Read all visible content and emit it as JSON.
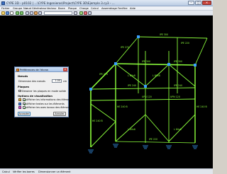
{
  "window": {
    "title": "CYPE 3D - p0102 | ...\\CYPE Ingenieros\\Project\\CYPE 3D\\Ejemplo 3.cy3 - ...",
    "minimize": "–",
    "maximize": "□",
    "close": "✕"
  },
  "menubar": {
    "items": [
      "Fichier",
      "Groupe",
      "Nœud",
      "Générateur",
      "Vecteur",
      "Barre",
      "Plaque",
      "Charge",
      "Calcul",
      "Assemblage",
      "Fenêtre",
      "Aide"
    ]
  },
  "toolbar": {
    "field": ""
  },
  "dialog": {
    "title": "Préférences de l'écran",
    "close": "✕",
    "group_nodes": "Nœuds",
    "node_size_label": "Dimension des nœuds",
    "node_size_value": "1.00",
    "node_size_unit": "cm",
    "group_plaques": "Plaques",
    "chk_plaques_label": "Dessiner les plaques en mode solide",
    "group_visualization": "Options de visualisation",
    "opt1_label": "Afficher les informations des éléments",
    "opt2_label": "Afficher textes sur les éléments",
    "opt3_label": "Afficher les axes locaux des éléments",
    "accept": "Accepter",
    "cancel": "Annuler"
  },
  "viewport": {
    "line_color": "#8cff3c",
    "node_color": "#3aa0ff",
    "labels": [
      "IPE 300",
      "IPE 300",
      "IPE 300",
      "HE 240 B",
      "HE 240 B",
      "HE 240 B",
      "IPE 270",
      "IPE 270",
      "IPE 240",
      "IPE 240",
      "L 80x8",
      "L 80x8",
      "L 80x8",
      "L 80x8",
      "UPN 120",
      "UPN 120",
      "IPE 220",
      "IPE 220"
    ]
  },
  "statusbar": {
    "items": [
      "Calcul",
      "Vérifier les barres",
      "Dimensionner un élément"
    ]
  }
}
